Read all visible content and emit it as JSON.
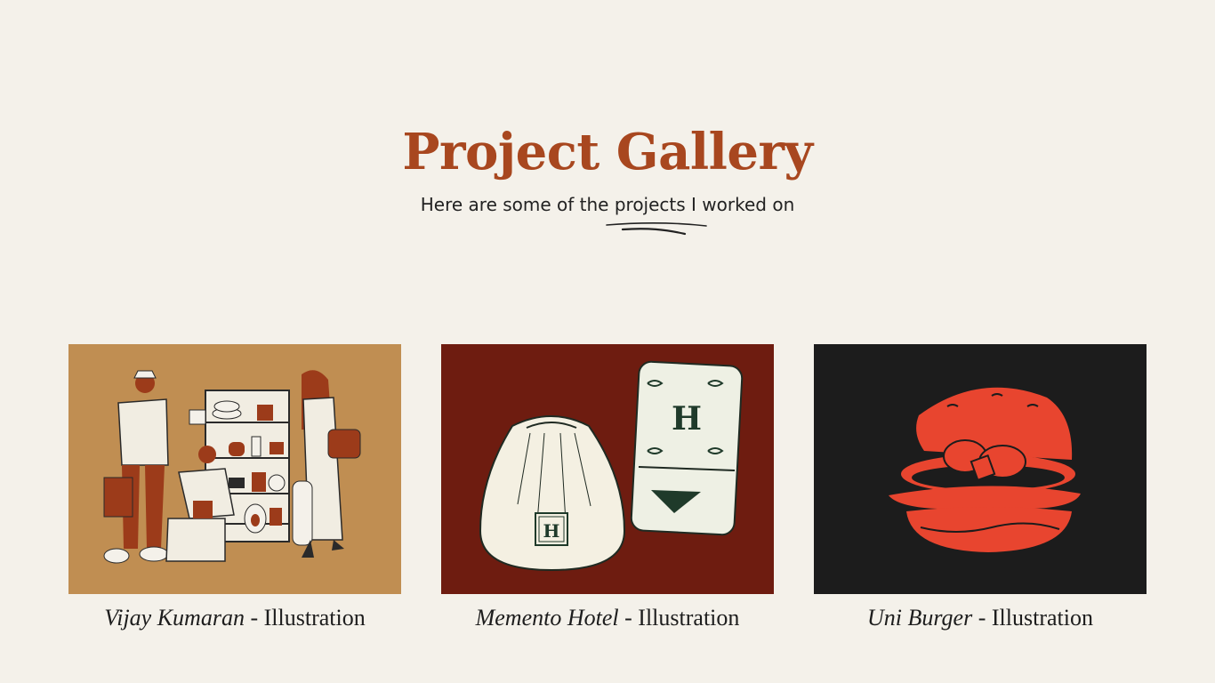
{
  "header": {
    "title": "Project Gallery",
    "subtitle": "Here are some of the projects I worked on"
  },
  "projects": [
    {
      "name": "Vijay Kumaran",
      "separator": " - ",
      "type": "Illustration",
      "bg_color": "#c08e52"
    },
    {
      "name": "Memento Hotel",
      "separator": " - ",
      "type": "Illustration",
      "bg_color": "#6e1c10"
    },
    {
      "name": "Uni Burger",
      "separator": " - ",
      "type": "Illustration",
      "bg_color": "#1c1c1c"
    }
  ],
  "colors": {
    "background": "#f4f1ea",
    "title": "#a8471f",
    "text": "#222222"
  }
}
